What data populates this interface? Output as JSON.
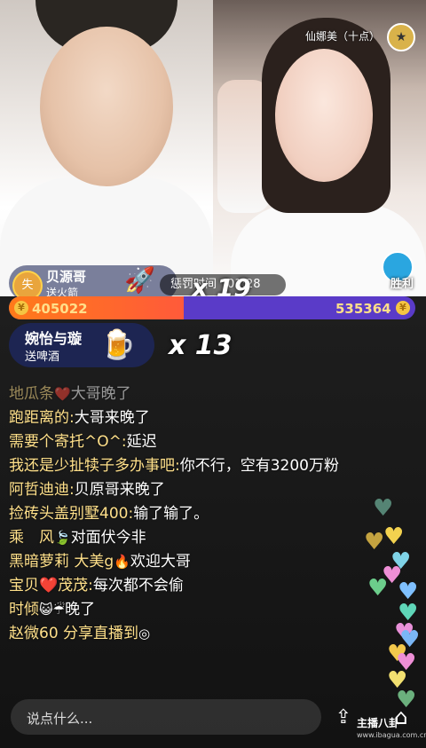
{
  "stream": {
    "guest_name": "仙娜美（十点）",
    "win_label": "胜利"
  },
  "gift_top": {
    "avatar_text": "失",
    "user": "贝源哥",
    "gift": "送火箭",
    "combo": "x 19"
  },
  "pk": {
    "label": "惩罚时间",
    "time": "01:28",
    "left_score": "405022",
    "right_score": "535364",
    "left_ratio": 0.43
  },
  "gift_second": {
    "user": "婉怡与璇",
    "gift": "送啤酒",
    "combo": "x 13"
  },
  "chat": [
    {
      "user": "地瓜条",
      "emoji": "❤️",
      "text": "大哥晚了",
      "faded": true
    },
    {
      "user": "跑距离的:",
      "emoji": "",
      "text": "大哥来晚了",
      "faded": false
    },
    {
      "user": "需要个寄托^O^:",
      "emoji": "",
      "text": "延迟",
      "faded": false
    },
    {
      "user": "我还是少扯犊子多办事吧:",
      "emoji": "",
      "text": "你不行，空有3200万粉",
      "faded": false
    },
    {
      "user": "阿哲迪迪:",
      "emoji": "",
      "text": "贝原哥来晚了",
      "faded": false
    },
    {
      "user": "捡砖头盖别墅400:",
      "emoji": "",
      "text": "输了输了。",
      "faded": false
    },
    {
      "user": "乘　风",
      "emoji": "🍃",
      "text": "对面伏今非",
      "faded": false
    },
    {
      "user": "黑暗萝莉 大美g",
      "emoji": "🔥",
      "text": "欢迎大哥",
      "faded": false
    },
    {
      "user": "宝贝❤️茂茂:",
      "emoji": "",
      "text": "每次都不会偷",
      "faded": false
    },
    {
      "user": "时倾",
      "emoji": "😺☔",
      "text": "晚了",
      "faded": false
    },
    {
      "user": "赵微60 分享直播到",
      "emoji": "◎",
      "text": "",
      "faded": false
    }
  ],
  "bottom": {
    "placeholder": "说点什么...",
    "watermark": "主播八卦",
    "watermark_url": "www.ibagua.com.cn"
  },
  "colors": {
    "pk_left": "#ff6a2a",
    "pk_right": "#5a3bc8",
    "username": "#ffe08a"
  }
}
